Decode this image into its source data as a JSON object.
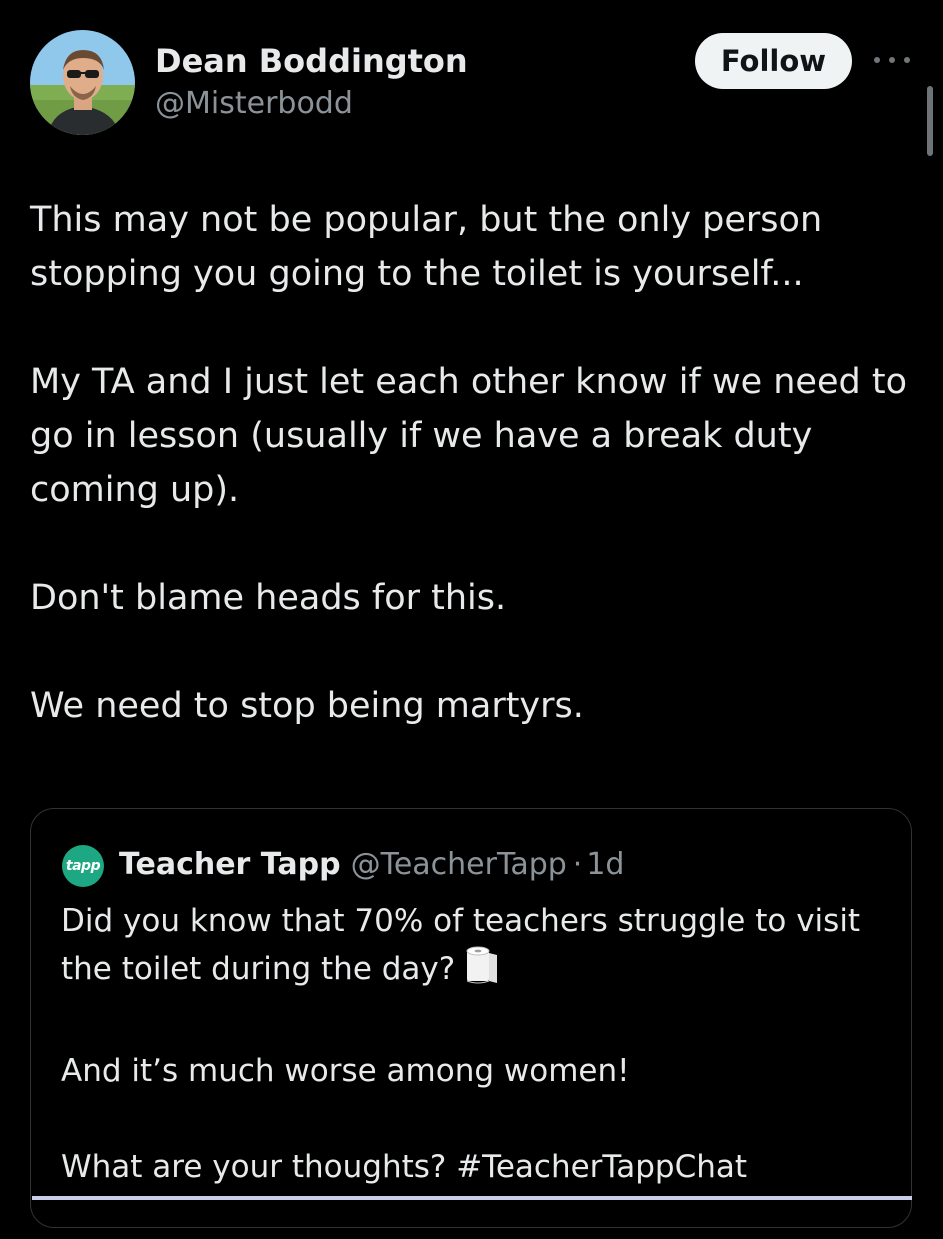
{
  "post": {
    "author_name": "Dean Boddington",
    "author_handle": "@Misterbodd",
    "follow_label": "Follow",
    "paragraphs": [
      "This may not be popular, but the only person stopping you going to the toilet is yourself...",
      "My TA and I just let each other know if we need to go in lesson (usually if we have a break duty coming up).",
      "Don't blame heads for this.",
      "We need to stop being martyrs."
    ]
  },
  "quote": {
    "logo_text": "tapp",
    "author_name": "Teacher Tapp",
    "author_handle": "@TeacherTapp",
    "separator": "·",
    "time": "1d",
    "line1": "Did you know that 70% of teachers struggle to visit the toilet during the day?",
    "emoji_icon": "toilet-paper-icon",
    "line2": "And it’s much worse among women!",
    "line3": "What are your thoughts? #TeacherTappChat"
  },
  "colors": {
    "background": "#000000",
    "text": "#e7e9ea",
    "muted": "#8b9399",
    "border": "#2f3336",
    "brand_green": "#1ea783"
  }
}
